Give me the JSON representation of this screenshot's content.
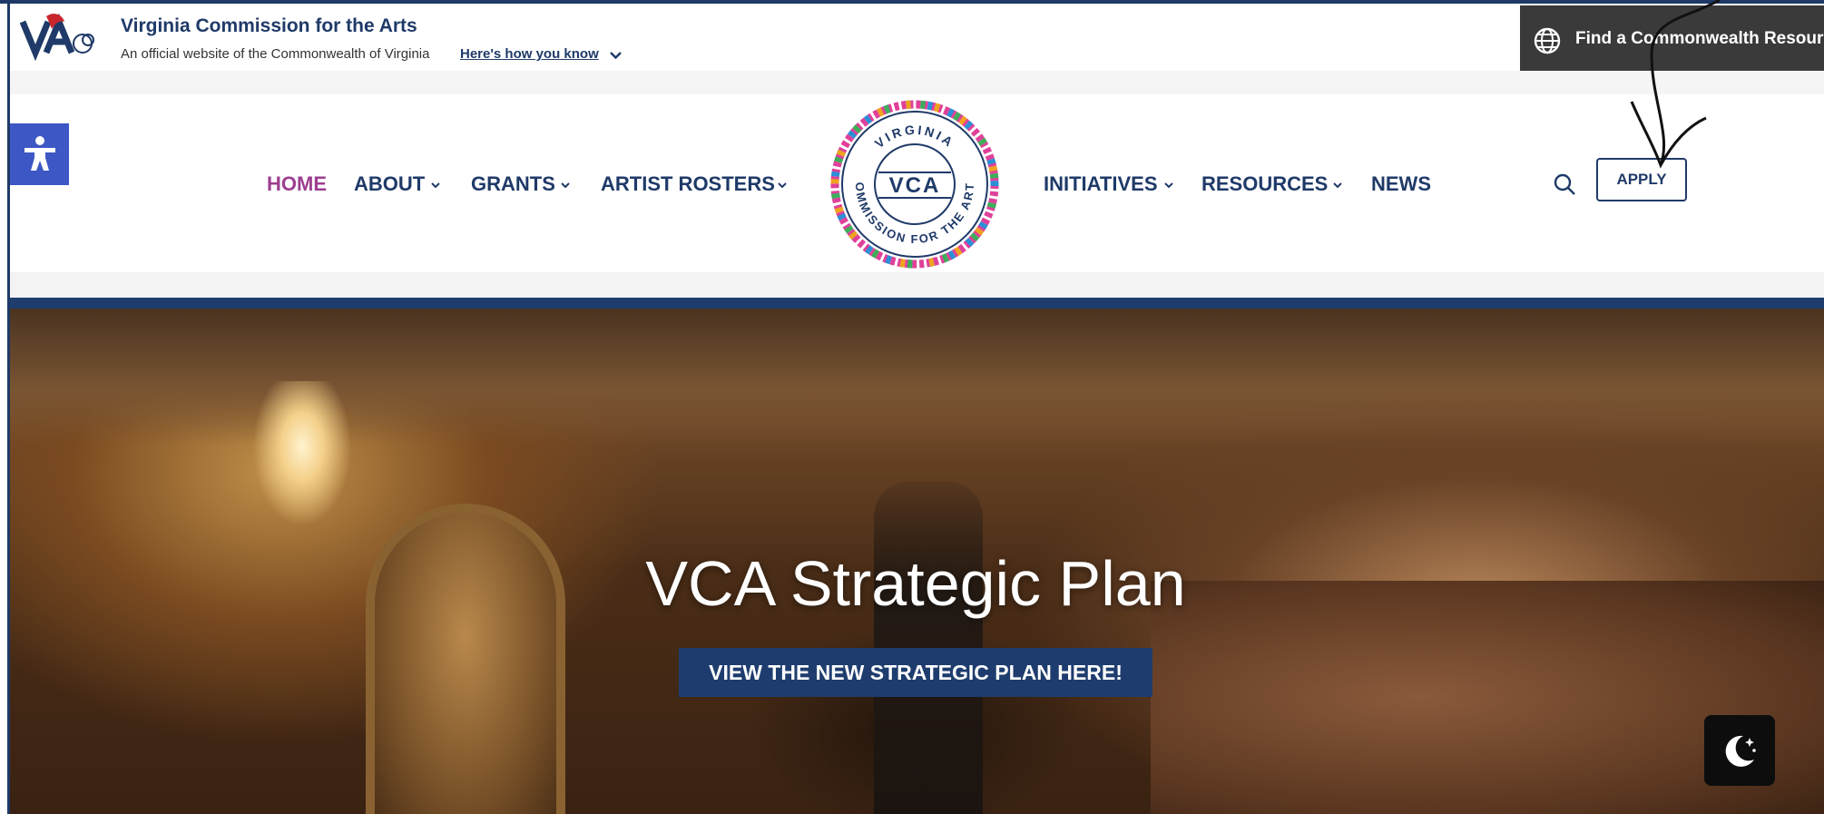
{
  "banner": {
    "title": "Virginia Commission for the Arts",
    "subtitle": "An official website of the Commonwealth of Virginia",
    "how_you_know": "Here's how you know",
    "resource_button": "Find a Commonwealth Resource"
  },
  "nav": {
    "items_left": [
      {
        "label": "HOME",
        "active": true
      },
      {
        "label": "ABOUT",
        "dropdown": true
      },
      {
        "label": "GRANTS",
        "dropdown": true
      },
      {
        "label": "ARTIST ROSTERS",
        "dropdown": true
      }
    ],
    "items_right": [
      {
        "label": "INITIATIVES",
        "dropdown": true
      },
      {
        "label": "RESOURCES",
        "dropdown": true
      },
      {
        "label": "NEWS"
      }
    ],
    "seal": {
      "top_text": "VIRGINIA",
      "center_text": "VCA",
      "bottom_text": "COMMISSION FOR THE ARTS"
    },
    "apply_label": "APPLY"
  },
  "hero": {
    "title": "VCA Strategic Plan",
    "cta": "VIEW THE NEW STRATEGIC PLAN HERE!"
  },
  "colors": {
    "brand_navy": "#1f3a68",
    "active_purple": "#9c3e8f",
    "accessibility_blue": "#3d57c4",
    "resource_bar": "#3a3a3a"
  },
  "icons": {
    "accessibility": "accessibility-icon",
    "search": "search-icon",
    "globe": "globe-icon",
    "dark_mode": "moon-icon"
  }
}
